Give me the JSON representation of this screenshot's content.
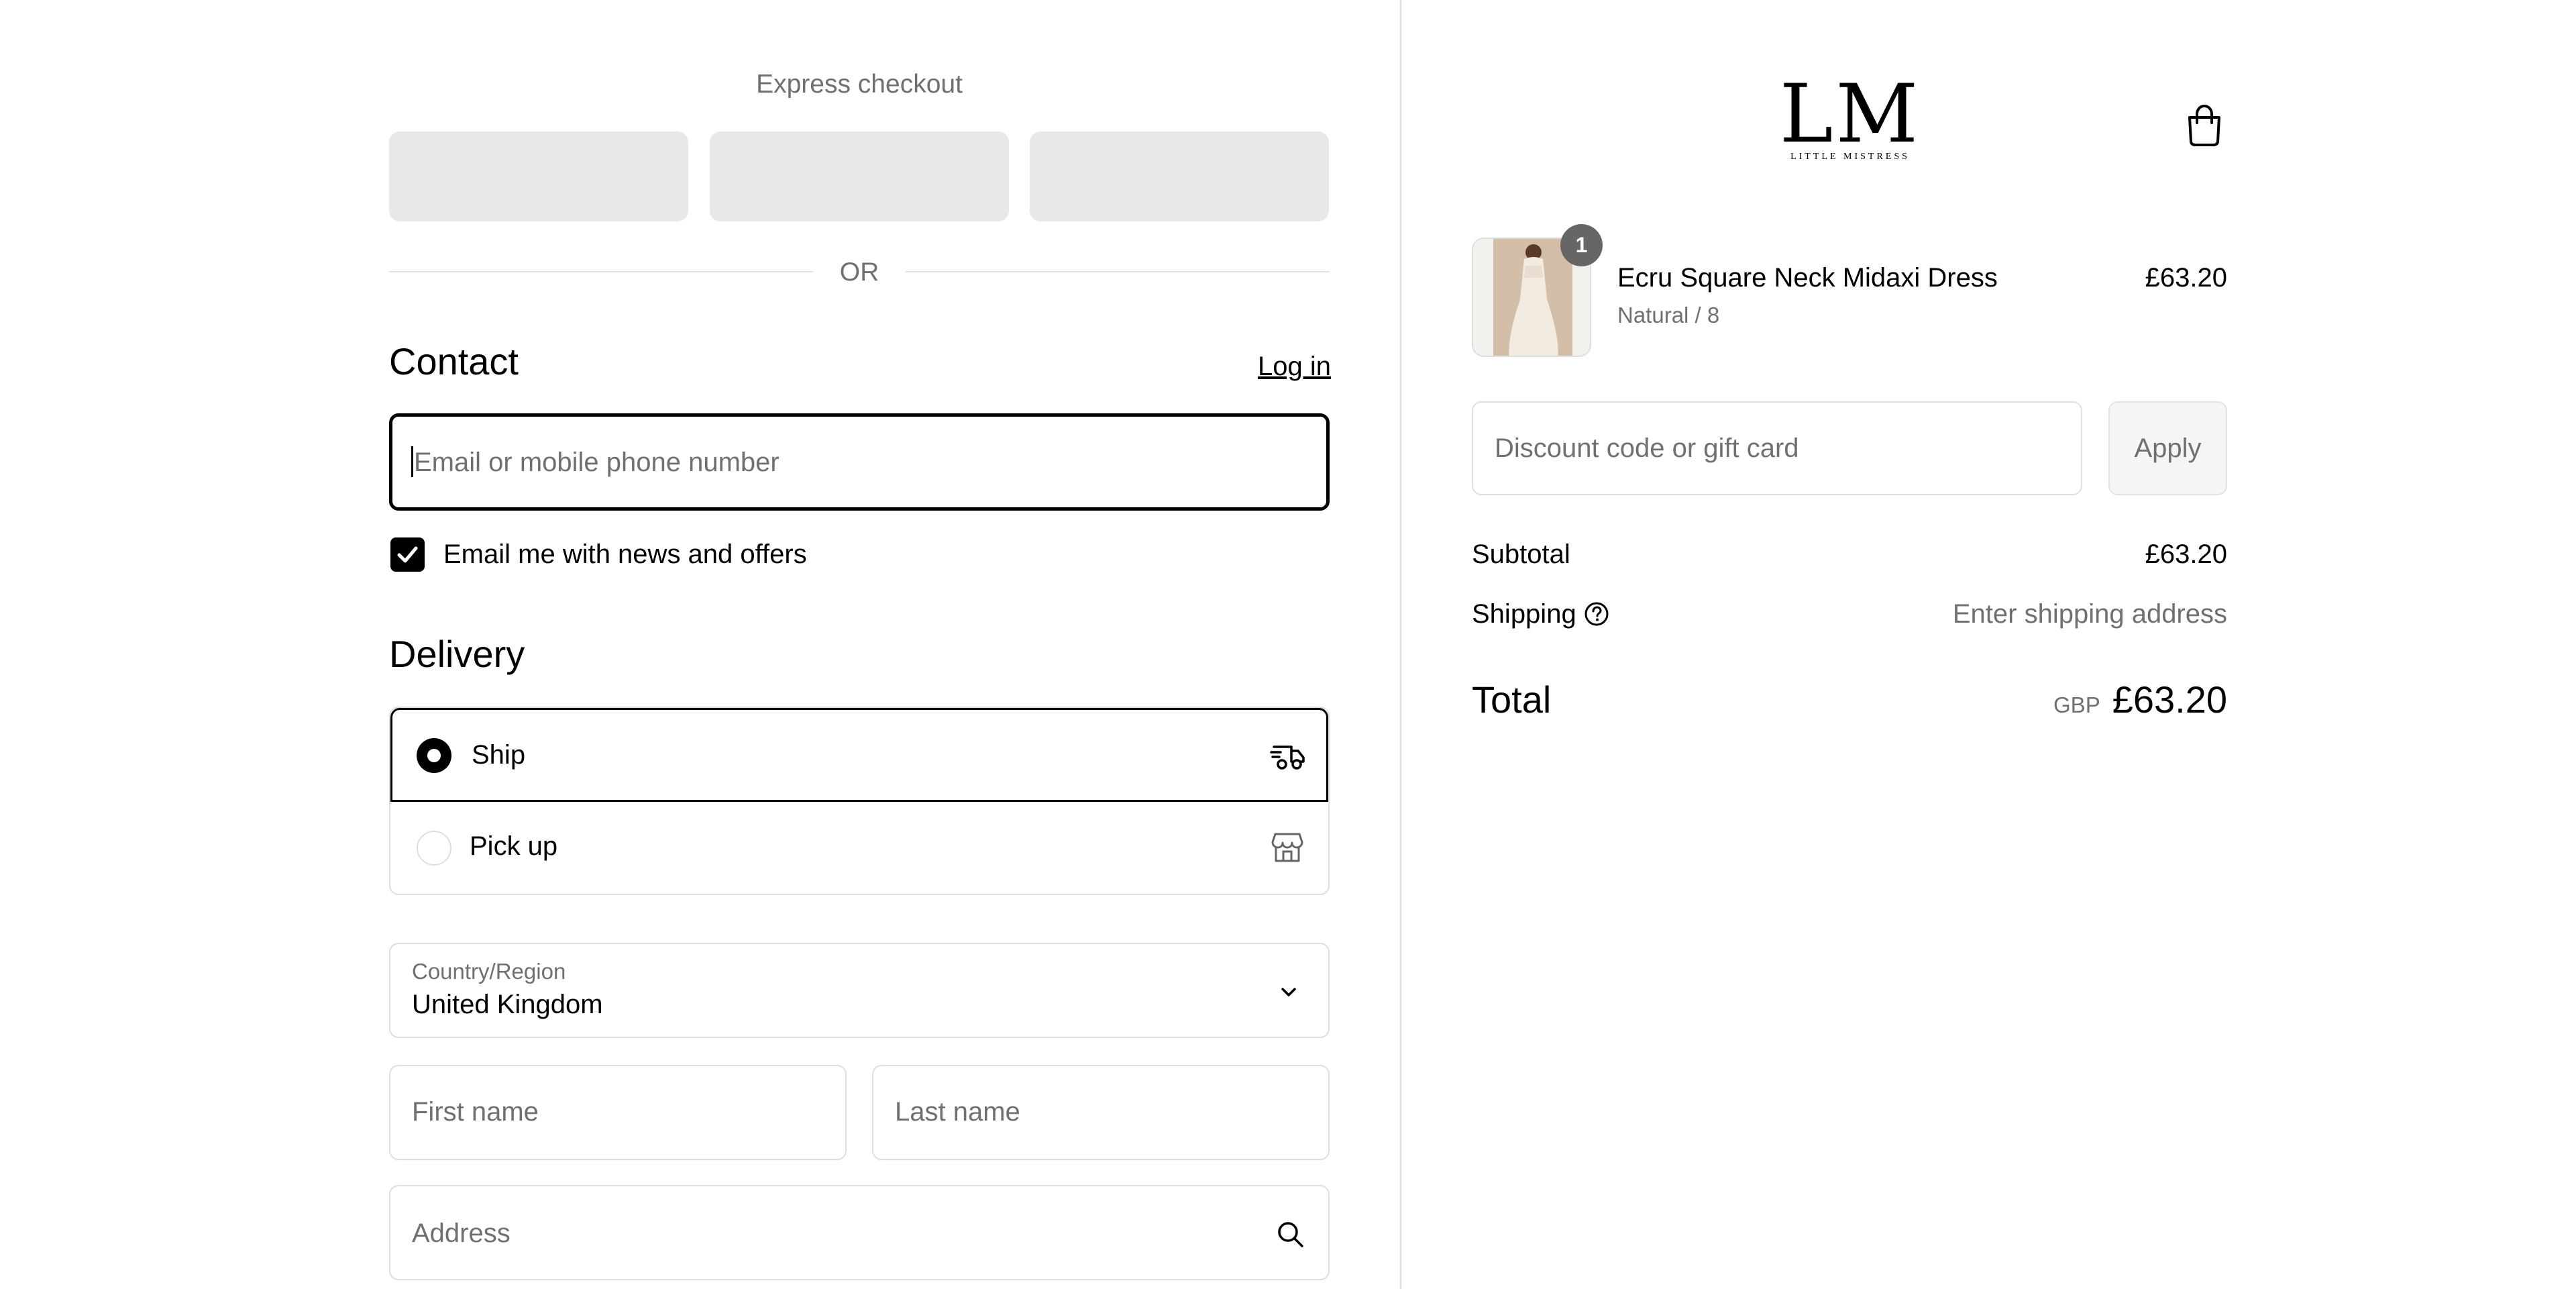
{
  "express": {
    "title": "Express checkout",
    "buttons": [
      "",
      "",
      ""
    ],
    "or": "OR"
  },
  "contact": {
    "heading": "Contact",
    "login": "Log in",
    "email_placeholder": "Email or mobile phone number",
    "newsletter_label": "Email me with news and offers",
    "newsletter_checked": true
  },
  "delivery": {
    "heading": "Delivery",
    "options": [
      {
        "label": "Ship",
        "selected": true,
        "icon": "truck-icon"
      },
      {
        "label": "Pick up",
        "selected": false,
        "icon": "store-icon"
      }
    ],
    "country_label": "Country/Region",
    "country_value": "United Kingdom",
    "first_name_placeholder": "First name",
    "last_name_placeholder": "Last name",
    "address_placeholder": "Address"
  },
  "brand": {
    "logo_text": "LM",
    "logo_subtext": "LITTLE MISTRESS"
  },
  "cart": {
    "items": [
      {
        "name": "Ecru Square Neck Midaxi Dress",
        "variant": "Natural / 8",
        "price": "£63.20",
        "quantity": "1"
      }
    ]
  },
  "discount": {
    "placeholder": "Discount code or gift card",
    "apply": "Apply"
  },
  "summary": {
    "subtotal_label": "Subtotal",
    "subtotal_value": "£63.20",
    "shipping_label": "Shipping",
    "shipping_value": "Enter shipping address",
    "total_label": "Total",
    "currency": "GBP",
    "total_value": "£63.20"
  },
  "colors": {
    "text": "#000000",
    "muted": "#707070",
    "border": "#dedede",
    "wallet_button": "#e8e8e8",
    "badge": "#666666"
  }
}
